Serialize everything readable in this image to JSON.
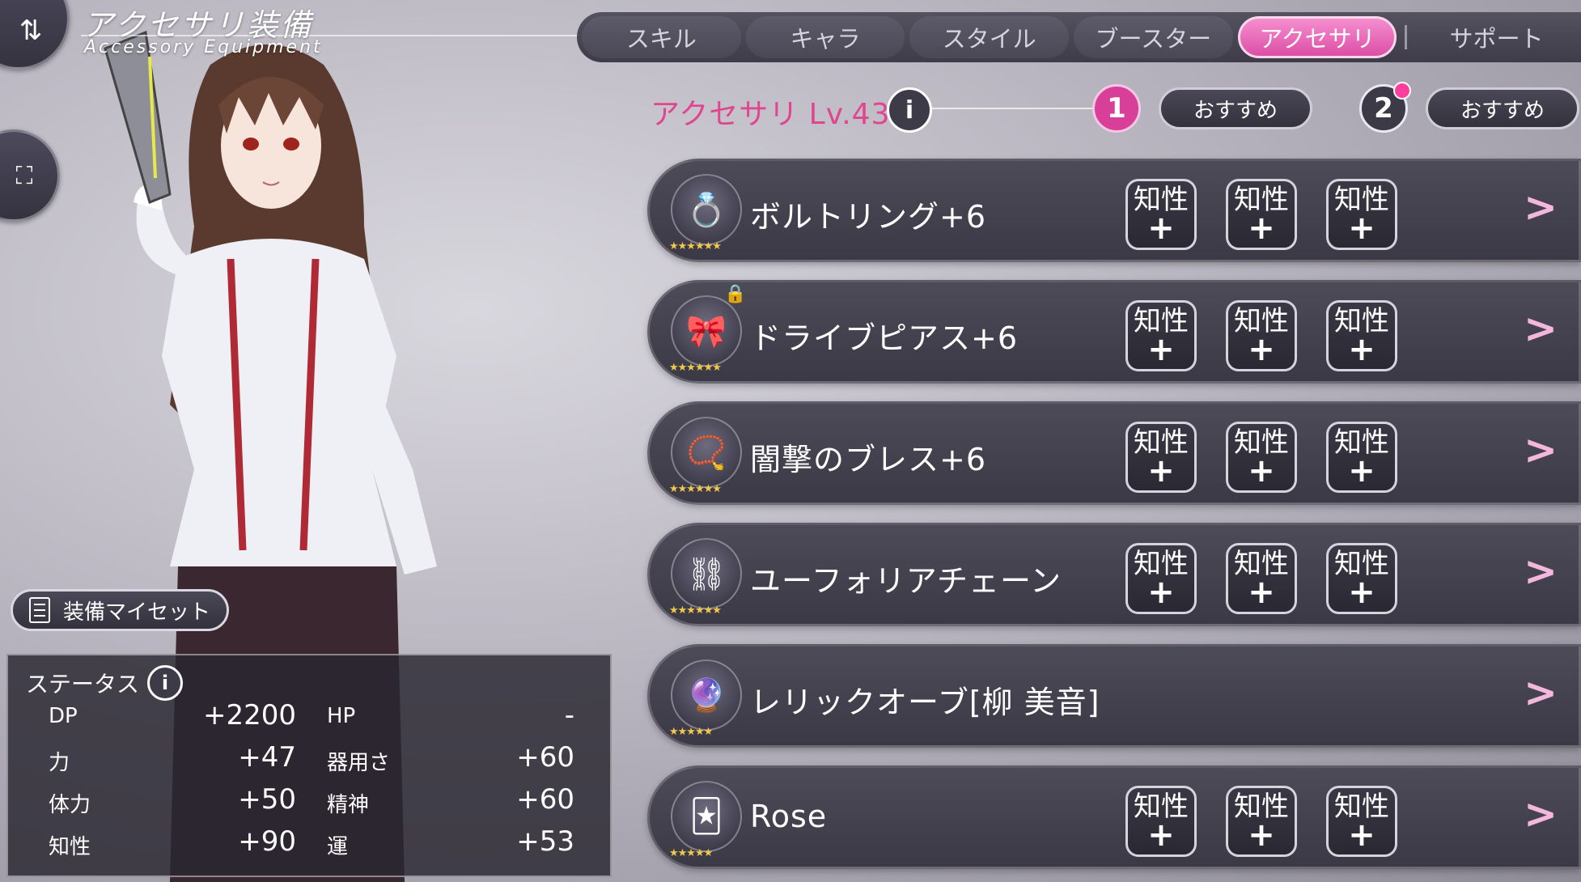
{
  "header": {
    "title_jp": "アクセサリ装備",
    "title_en": "Accessory Equipment"
  },
  "tabs": [
    {
      "label": "スキル",
      "active": false
    },
    {
      "label": "キャラ",
      "active": false
    },
    {
      "label": "スタイル",
      "active": false
    },
    {
      "label": "ブースター",
      "active": false
    },
    {
      "label": "アクセサリ",
      "active": true
    },
    {
      "label": "サポート",
      "active": false
    }
  ],
  "level": {
    "label": "アクセサリ Lv.43"
  },
  "loadouts": [
    {
      "number": "1",
      "recommend_label": "おすすめ",
      "active": true
    },
    {
      "number": "2",
      "recommend_label": "おすすめ",
      "active": false
    }
  ],
  "accessories": [
    {
      "name": "ボルトリング+6",
      "icon": "ring-icon",
      "rarity": "★★★★★★",
      "slots": [
        "知性",
        "知性",
        "知性"
      ]
    },
    {
      "name": "ドライブピアス+6",
      "icon": "earring-icon",
      "rarity": "★★★★★★",
      "slots": [
        "知性",
        "知性",
        "知性"
      ],
      "locked": true
    },
    {
      "name": "闇撃のブレス+6",
      "icon": "bracelet-icon",
      "rarity": "★★★★★★",
      "slots": [
        "知性",
        "知性",
        "知性"
      ]
    },
    {
      "name": "ユーフォリアチェーン",
      "icon": "chain-icon",
      "rarity": "★★★★★★",
      "slots": [
        "知性",
        "知性",
        "知性"
      ]
    },
    {
      "name": "レリックオーブ[柳 美音]",
      "icon": "orb-icon",
      "rarity": "★★★★★",
      "slots": []
    },
    {
      "name": "Rose",
      "icon": "rose-card-icon",
      "rarity": "★★★★★",
      "slots": [
        "知性",
        "知性",
        "知性"
      ]
    }
  ],
  "slot_plus": "+",
  "preset_button": "装備マイセット",
  "status": {
    "title": "ステータス",
    "stats_left": [
      {
        "label": "DP",
        "value": "+2200"
      },
      {
        "label": "力",
        "value": "+47"
      },
      {
        "label": "体力",
        "value": "+50"
      },
      {
        "label": "知性",
        "value": "+90"
      }
    ],
    "stats_right": [
      {
        "label": "HP",
        "value": "-"
      },
      {
        "label": "器用さ",
        "value": "+60"
      },
      {
        "label": "精神",
        "value": "+60"
      },
      {
        "label": "運",
        "value": "+53"
      }
    ]
  },
  "colors": {
    "accent_pink": "#e0458f",
    "tab_active": "#dc4ea6",
    "panel_dark": "#3b3945"
  }
}
